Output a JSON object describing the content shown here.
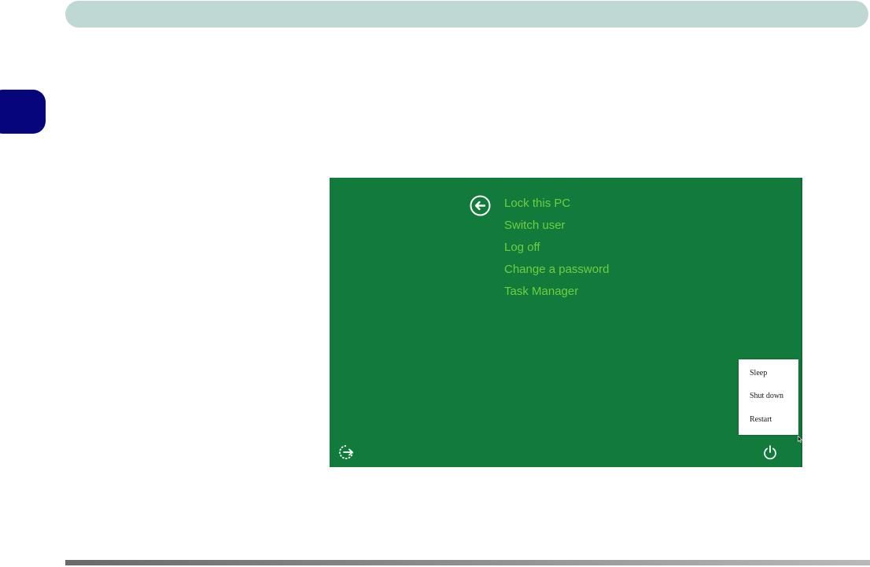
{
  "screen": {
    "background_color": "#127a3b",
    "accent_text_color": "#6fcf3f",
    "back_icon": "back-arrow-circle-icon",
    "options": [
      {
        "label": "Lock this PC"
      },
      {
        "label": "Switch user"
      },
      {
        "label": "Log off"
      },
      {
        "label": "Change a password"
      },
      {
        "label": "Task Manager"
      }
    ],
    "power_menu": {
      "items": [
        {
          "label": "Sleep"
        },
        {
          "label": "Shut down"
        },
        {
          "label": "Restart"
        }
      ]
    },
    "ease_of_access_icon": "ease-of-access-icon",
    "power_icon": "power-icon"
  },
  "document": {
    "top_bar_color": "#bfd8d4",
    "chapter_tab_color": "#07057a"
  }
}
